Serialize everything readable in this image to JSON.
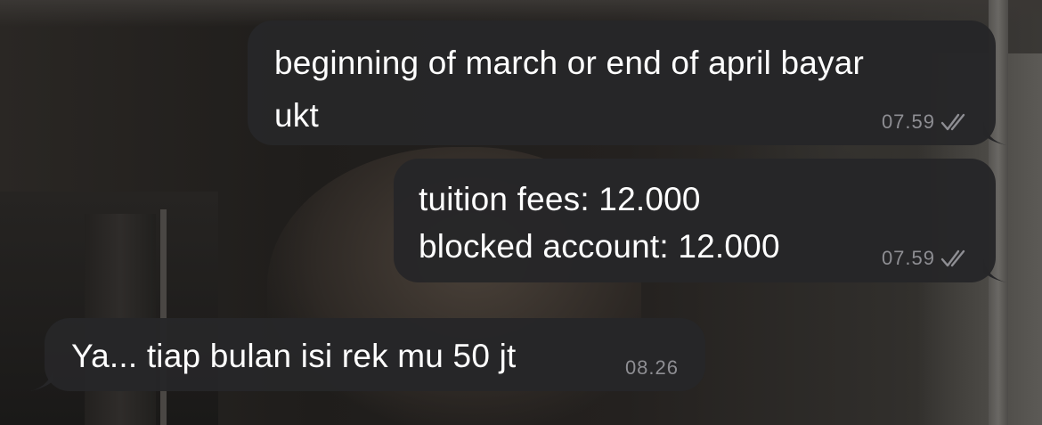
{
  "messages": [
    {
      "direction": "outgoing",
      "lines": [
        "beginning of march or end of april bayar",
        "ukt"
      ],
      "time": "07.59",
      "status_icon": "double-check-icon"
    },
    {
      "direction": "outgoing",
      "lines": [
        "tuition fees: 12.000",
        "blocked account: 12.000"
      ],
      "time": "07.59",
      "status_icon": "double-check-icon"
    },
    {
      "direction": "incoming",
      "lines": [
        "Ya... tiap bulan isi rek mu 50 jt"
      ],
      "time": "08.26"
    }
  ],
  "colors": {
    "bubble": "#262628",
    "text": "#ffffff",
    "meta": "#8e8e93"
  }
}
